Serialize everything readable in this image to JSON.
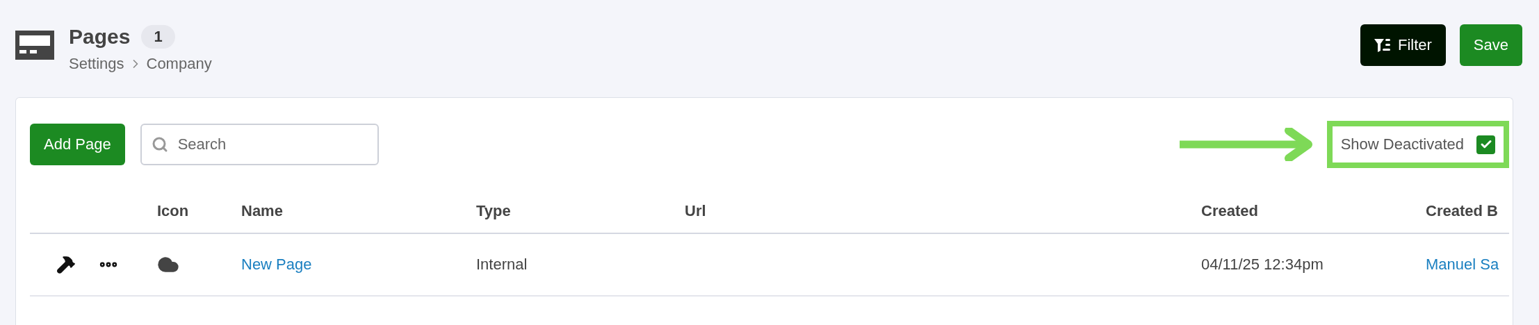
{
  "header": {
    "title": "Pages",
    "count": "1",
    "breadcrumb": [
      "Settings",
      "Company"
    ]
  },
  "actions": [
    {
      "kind": "filter",
      "label": "Filter"
    },
    {
      "kind": "save",
      "label": "Save"
    }
  ],
  "toolbar": {
    "add_button": "Add Page",
    "search": {
      "placeholder": "Search"
    },
    "show_deactivated": {
      "label": "Show Deactivated",
      "checked": true,
      "highlighted": true
    }
  },
  "table": {
    "columns": [
      "",
      "Icon",
      "Name",
      "Type",
      "Url",
      "Created",
      "Created B"
    ],
    "rows": [
      {
        "name": "New Page",
        "type": "Internal",
        "url": "",
        "created": "04/11/25 12:34pm",
        "created_by": "Manuel Sa"
      }
    ]
  }
}
